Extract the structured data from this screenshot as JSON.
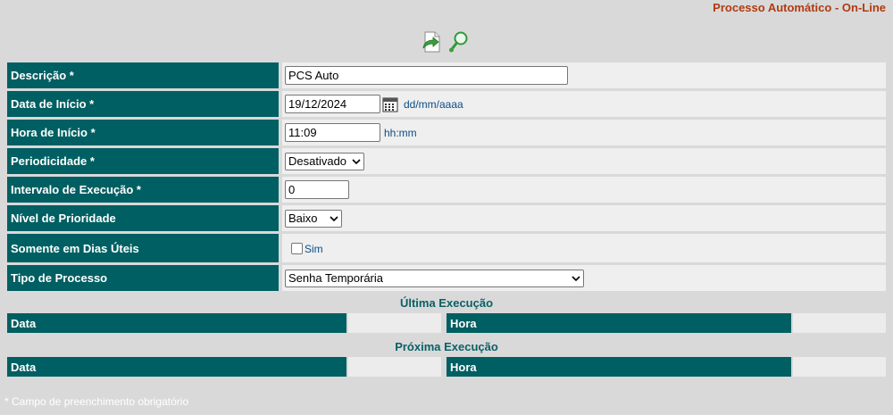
{
  "page_title": "Processo Automático - On-Line",
  "toolbar": {
    "icons": [
      "forward-page-icon",
      "search-magnifier-icon"
    ]
  },
  "form": {
    "descricao": {
      "label": "Descrição *",
      "value": "PCS Auto"
    },
    "data_inicio": {
      "label": "Data de Início *",
      "value": "19/12/2024",
      "hint": "dd/mm/aaaa"
    },
    "hora_inicio": {
      "label": "Hora de Início *",
      "value": "11:09",
      "hint": "hh:mm"
    },
    "periodicidade": {
      "label": "Periodicidade *",
      "selected": "Desativado"
    },
    "intervalo": {
      "label": "Intervalo de Execução *",
      "value": "0"
    },
    "prioridade": {
      "label": "Nível de Prioridade",
      "selected": "Baixo"
    },
    "dias_uteis": {
      "label": "Somente em Dias Úteis",
      "option": "Sim",
      "checked": false
    },
    "tipo_processo": {
      "label": "Tipo de Processo",
      "selected": "Senha Temporária"
    }
  },
  "ultima_execucao": {
    "title": "Última Execução",
    "data_label": "Data",
    "data_value": "",
    "hora_label": "Hora",
    "hora_value": ""
  },
  "proxima_execucao": {
    "title": "Próxima Execução",
    "data_label": "Data",
    "data_value": "",
    "hora_label": "Hora",
    "hora_value": ""
  },
  "footer_note": "* Campo de preenchimento obrigatório",
  "colors": {
    "label_bg": "#005f62",
    "page_bg": "#d9d9d9",
    "title_accent": "#b23a10",
    "hint_text": "#0b4e86"
  }
}
